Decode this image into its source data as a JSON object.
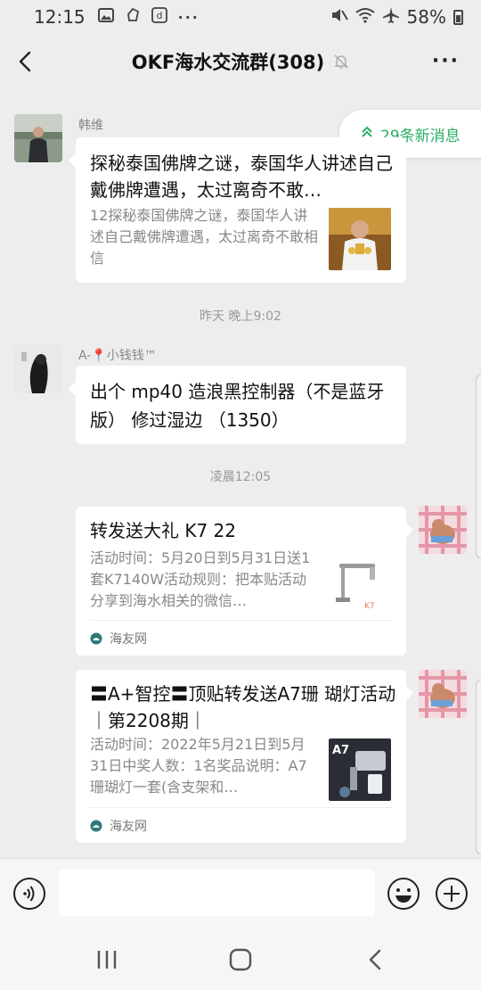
{
  "status_bar": {
    "time": "12:15",
    "left_icons": [
      "gallery-icon",
      "app-icon",
      "tiktok-icon",
      "more-dots-icon"
    ],
    "right_icons": [
      "mute-icon",
      "wifi-icon",
      "airplane-icon"
    ],
    "battery_percent": "58%",
    "battery_level": 0.58
  },
  "header": {
    "title": "OKF海水交流群(308)",
    "muted": true
  },
  "new_messages_pill": {
    "label": "29条新消息",
    "arrow_glyph": "⌃",
    "color": "#2aae67"
  },
  "messages": [
    {
      "type": "link_card",
      "side": "left",
      "sender": "韩维",
      "title": "探秘泰国佛牌之谜，泰国华人讲述自己戴佛牌遭遇，太过离奇不敢…",
      "description": "12探秘泰国佛牌之谜，泰国华人讲述自己戴佛牌遭遇，太过离奇不敢相信",
      "source": ""
    },
    {
      "type": "timestamp",
      "text": "昨天 晚上9:02"
    },
    {
      "type": "text",
      "side": "left",
      "sender": "A-📍小钱钱™",
      "text": "出个 mp40 造浪黑控制器（不是蓝牙版） 修过湿边 （1350）"
    },
    {
      "type": "timestamp",
      "text": "凌晨12:05"
    },
    {
      "type": "link_card",
      "side": "right",
      "title": "转发送大礼 K7 22",
      "description": "活动时间：5月20日到5月31日送1套K7140W活动规则：把本贴活动分享到海水相关的微信…",
      "source": "海友网"
    },
    {
      "type": "link_card",
      "side": "right",
      "title": "〓A+智控〓顶贴转发送A7珊 瑚灯活动｜第2208期｜",
      "description": "活动时间：2022年5月21日到5月31日中奖人数：1名奖品说明：A7珊瑚灯一套(含支架和…",
      "source": "海友网",
      "thumb_label": "A7"
    }
  ],
  "input_bar": {
    "placeholder": "",
    "icons": [
      "voice-icon",
      "emoji-icon",
      "plus-icon"
    ]
  },
  "nav_bar": {
    "icons": [
      "recent-apps-icon",
      "home-icon",
      "back-icon"
    ]
  }
}
